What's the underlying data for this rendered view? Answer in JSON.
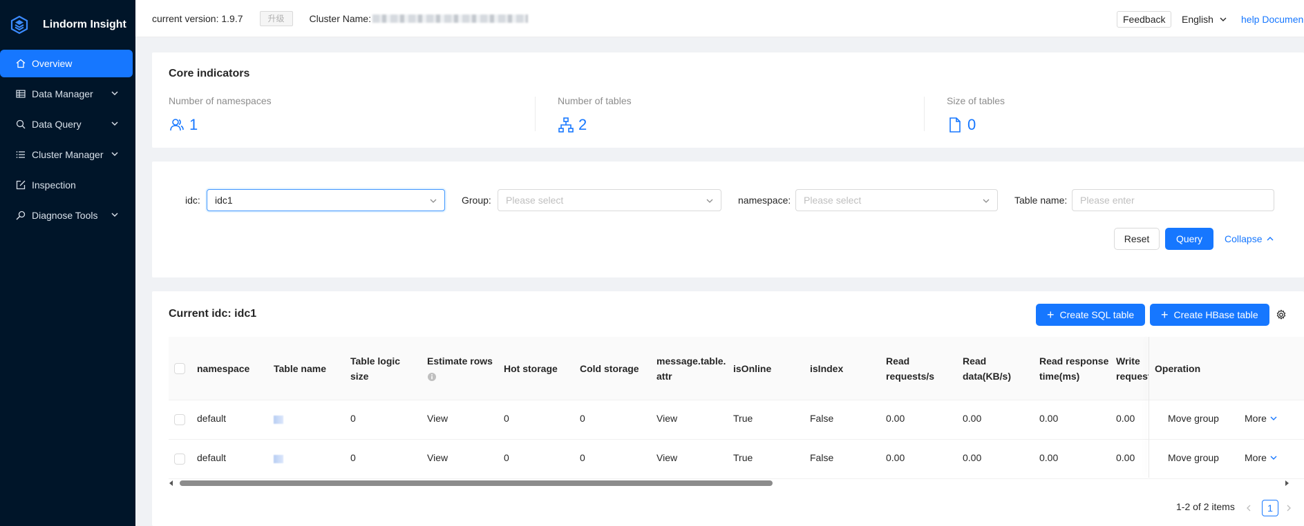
{
  "brand": {
    "name": "Lindorm Insight",
    "accent": "#1677ff",
    "sidebar_bg": "#001529"
  },
  "sidebar": {
    "items": [
      {
        "label": "Overview",
        "icon": "home-icon",
        "active": true
      },
      {
        "label": "Data Manager",
        "icon": "table-icon",
        "expandable": true
      },
      {
        "label": "Data Query",
        "icon": "search-icon",
        "expandable": true
      },
      {
        "label": "Cluster Manager",
        "icon": "list-icon",
        "expandable": true
      },
      {
        "label": "Inspection",
        "icon": "external-edit-icon"
      },
      {
        "label": "Diagnose Tools",
        "icon": "wrench-search-icon",
        "expandable": true
      }
    ]
  },
  "header": {
    "version": "current version: 1.9.7",
    "upgrade": "升级",
    "cluster_label": "Cluster Name:",
    "feedback": "Feedback",
    "language": "English",
    "help": "help Documen"
  },
  "core": {
    "title": "Core indicators",
    "stats": [
      {
        "label": "Number of namespaces",
        "value": "1",
        "icon": "users-icon"
      },
      {
        "label": "Number of tables",
        "value": "2",
        "icon": "hierarchy-icon"
      },
      {
        "label": "Size of tables",
        "value": "0",
        "icon": "file-icon"
      }
    ]
  },
  "filters": {
    "idc_label": "idc:",
    "idc_value": "idc1",
    "group_label": "Group:",
    "group_placeholder": "Please select",
    "namespace_label": "namespace:",
    "namespace_placeholder": "Please select",
    "table_label": "Table name:",
    "table_placeholder": "Please enter",
    "reset": "Reset",
    "query": "Query",
    "collapse": "Collapse"
  },
  "table_section": {
    "title": "Current idc: idc1",
    "create_sql": "Create SQL table",
    "create_hbase": "Create HBase table",
    "columns": {
      "namespace": "namespace",
      "table_name": "Table name",
      "logic_size_1": "Table logic",
      "logic_size_2": "size",
      "estimate_rows": "Estimate rows",
      "hot": "Hot storage",
      "cold": "Cold storage",
      "attr_1": "message.table.",
      "attr_2": "attr",
      "is_online": "isOnline",
      "is_index": "isIndex",
      "read_req_1": "Read",
      "read_req_2": "requests/s",
      "read_data_1": "Read",
      "read_data_2": "data(KB/s)",
      "read_resp_1": "Read response",
      "read_resp_2": "time(ms)",
      "write_req_1": "Write",
      "write_req_2": "requests",
      "operation": "Operation"
    },
    "rows": [
      {
        "namespace": "default",
        "logic_size": "0",
        "estimate": "View",
        "hot": "0",
        "cold": "0",
        "attr": "View",
        "online": "True",
        "index": "False",
        "read_req": "0.00",
        "read_data": "0.00",
        "read_resp": "0.00",
        "write_req": "0.00",
        "op_move": "Move group",
        "op_more": "More"
      },
      {
        "namespace": "default",
        "logic_size": "0",
        "estimate": "View",
        "hot": "0",
        "cold": "0",
        "attr": "View",
        "online": "True",
        "index": "False",
        "read_req": "0.00",
        "read_data": "0.00",
        "read_resp": "0.00",
        "write_req": "0.00",
        "op_move": "Move group",
        "op_more": "More"
      }
    ],
    "pagination": {
      "summary": "1-2 of 2 items",
      "current_page": "1"
    }
  }
}
